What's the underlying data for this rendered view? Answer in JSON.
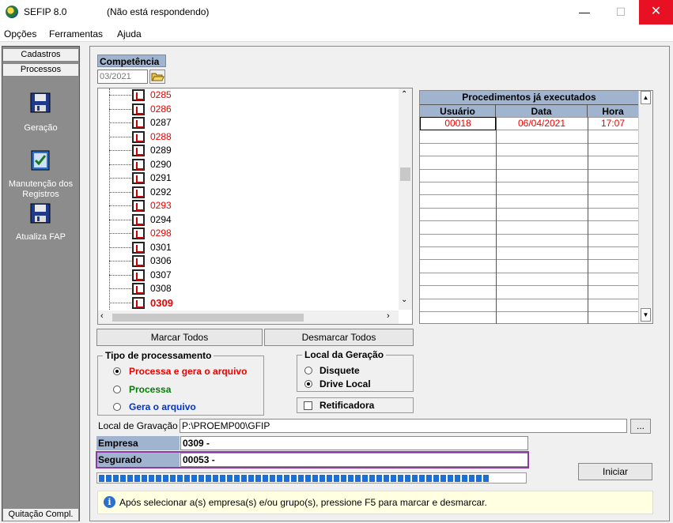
{
  "window": {
    "title": "SEFIP 8.0",
    "status": "(Não está respondendo)",
    "minimize": "—",
    "maximize": "☐",
    "close": "✕"
  },
  "menu": [
    "Opções",
    "Ferramentas",
    "Ajuda"
  ],
  "sidebar": {
    "tabs": [
      "Cadastros",
      "Processos"
    ],
    "items": [
      {
        "label": "Geração",
        "icon": "floppy-disk-icon"
      },
      {
        "label": "Manutenção dos Registros",
        "icon": "checklist-icon"
      },
      {
        "label": "Atualiza FAP",
        "icon": "floppy-disk-icon"
      }
    ],
    "bottom": "Quitação Compl."
  },
  "competencia": {
    "label": "Competência",
    "value": "03/2021"
  },
  "tree": {
    "items": [
      {
        "code": "0285",
        "red": true,
        "bold": false
      },
      {
        "code": "0286",
        "red": true,
        "bold": false
      },
      {
        "code": "0287",
        "red": false,
        "bold": false
      },
      {
        "code": "0288",
        "red": true,
        "bold": false
      },
      {
        "code": "0289",
        "red": false,
        "bold": false
      },
      {
        "code": "0290",
        "red": false,
        "bold": false
      },
      {
        "code": "0291",
        "red": false,
        "bold": false
      },
      {
        "code": "0292",
        "red": false,
        "bold": false
      },
      {
        "code": "0293",
        "red": true,
        "bold": false
      },
      {
        "code": "0294",
        "red": false,
        "bold": false
      },
      {
        "code": "0298",
        "red": true,
        "bold": false
      },
      {
        "code": "0301",
        "red": false,
        "bold": false
      },
      {
        "code": "0306",
        "red": false,
        "bold": false
      },
      {
        "code": "0307",
        "red": false,
        "bold": false
      },
      {
        "code": "0308",
        "red": false,
        "bold": false
      },
      {
        "code": "0309",
        "red": true,
        "bold": true
      }
    ]
  },
  "procedimentos": {
    "title": "Procedimentos já executados",
    "columns": [
      "Usuário",
      "Data",
      "Hora"
    ],
    "rows": [
      [
        "00018",
        "06/04/2021",
        "17:07"
      ]
    ]
  },
  "buttons": {
    "marcar": "Marcar Todos",
    "desmarcar": "Desmarcar Todos",
    "iniciar": "Iniciar",
    "browse": "..."
  },
  "tipo": {
    "title": "Tipo de processamento",
    "options": [
      "Processa e gera o arquivo",
      "Processa",
      "Gera o arquivo"
    ],
    "selected": 0
  },
  "local": {
    "title": "Local da Geração",
    "options": [
      "Disquete",
      "Drive Local"
    ],
    "selected": 1
  },
  "retificadora": "Retificadora",
  "gravacao": {
    "label": "Local de Gravação",
    "value": "P:\\PROEMP00\\GFIP"
  },
  "empresa": {
    "label": "Empresa",
    "value": "0309 -"
  },
  "segurado": {
    "label": "Segurado",
    "value": "00053 -"
  },
  "progress": {
    "percent": 92
  },
  "hint": "Após selecionar a(s) empresa(s) e/ou grupo(s), pressione F5 para marcar e desmarcar.",
  "colors": {
    "header_blue": "#a0b4cf",
    "red_text": "#e00000",
    "progress_blue": "#1a6fd8",
    "highlight_purple": "#8a3ba8"
  }
}
